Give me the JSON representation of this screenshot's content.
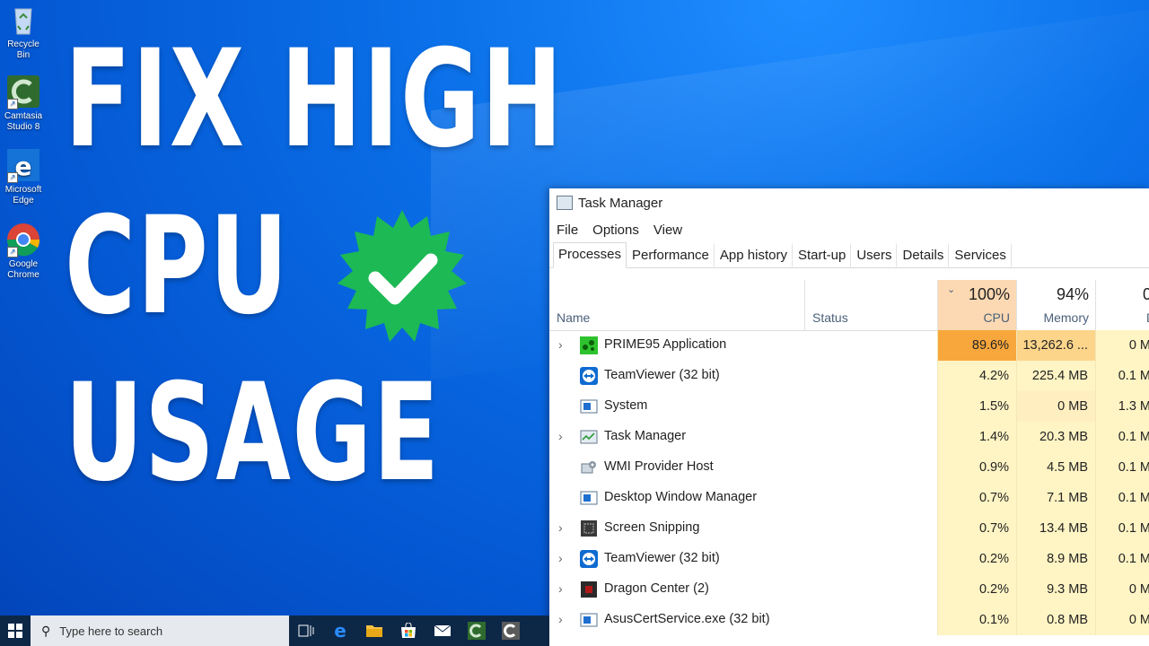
{
  "desktop": {
    "icons": [
      {
        "label_line1": "Recycle Bin",
        "label_line2": "",
        "icon": "recycle-bin-icon"
      },
      {
        "label_line1": "Camtasia",
        "label_line2": "Studio 8",
        "icon": "camtasia-icon"
      },
      {
        "label_line1": "Microsoft",
        "label_line2": "Edge",
        "icon": "edge-icon"
      },
      {
        "label_line1": "Google",
        "label_line2": "Chrome",
        "icon": "chrome-icon"
      }
    ]
  },
  "headline": {
    "line1": "FIX HIGH",
    "line2": "CPU",
    "line3": "USAGE",
    "badge_icon": "verified-check-badge-icon",
    "badge_color": "#1db954"
  },
  "task_manager": {
    "title": "Task Manager",
    "menu": [
      "File",
      "Options",
      "View"
    ],
    "tabs": [
      "Processes",
      "Performance",
      "App history",
      "Start-up",
      "Users",
      "Details",
      "Services"
    ],
    "active_tab": "Processes",
    "columns": {
      "name": "Name",
      "status": "Status",
      "cpu_pct": "100%",
      "cpu": "CPU",
      "mem_pct": "94%",
      "mem": "Memory",
      "disk_pct": "0",
      "disk": "D"
    },
    "processes": [
      {
        "name": "PRIME95 Application",
        "expandable": true,
        "icon": "prime95-icon",
        "cpu": "89.6%",
        "memory": "13,262.6 ...",
        "disk": "0 M"
      },
      {
        "name": "TeamViewer (32 bit)",
        "expandable": false,
        "icon": "teamviewer-icon",
        "cpu": "4.2%",
        "memory": "225.4 MB",
        "disk": "0.1 M"
      },
      {
        "name": "System",
        "expandable": false,
        "icon": "system-icon",
        "cpu": "1.5%",
        "memory": "0 MB",
        "disk": "1.3 M"
      },
      {
        "name": "Task Manager",
        "expandable": true,
        "icon": "task-manager-icon",
        "cpu": "1.4%",
        "memory": "20.3 MB",
        "disk": "0.1 M"
      },
      {
        "name": "WMI Provider Host",
        "expandable": false,
        "icon": "wmi-icon",
        "cpu": "0.9%",
        "memory": "4.5 MB",
        "disk": "0.1 M"
      },
      {
        "name": "Desktop Window Manager",
        "expandable": false,
        "icon": "dwm-icon",
        "cpu": "0.7%",
        "memory": "7.1 MB",
        "disk": "0.1 M"
      },
      {
        "name": "Screen Snipping",
        "expandable": true,
        "icon": "screen-snipping-icon",
        "cpu": "0.7%",
        "memory": "13.4 MB",
        "disk": "0.1 M"
      },
      {
        "name": "TeamViewer (32 bit)",
        "expandable": true,
        "icon": "teamviewer-icon",
        "cpu": "0.2%",
        "memory": "8.9 MB",
        "disk": "0.1 M"
      },
      {
        "name": "Dragon Center (2)",
        "expandable": true,
        "icon": "dragon-center-icon",
        "cpu": "0.2%",
        "memory": "9.3 MB",
        "disk": "0 M"
      },
      {
        "name": "AsusCertService.exe (32 bit)",
        "expandable": true,
        "icon": "service-icon",
        "cpu": "0.1%",
        "memory": "0.8 MB",
        "disk": "0 M"
      }
    ]
  },
  "taskbar": {
    "search_placeholder": "Type here to search",
    "pinned": [
      "task-view-icon",
      "edge-icon",
      "file-explorer-icon",
      "store-icon",
      "mail-icon",
      "camtasia-icon",
      "camtasia-recorder-icon"
    ]
  }
}
